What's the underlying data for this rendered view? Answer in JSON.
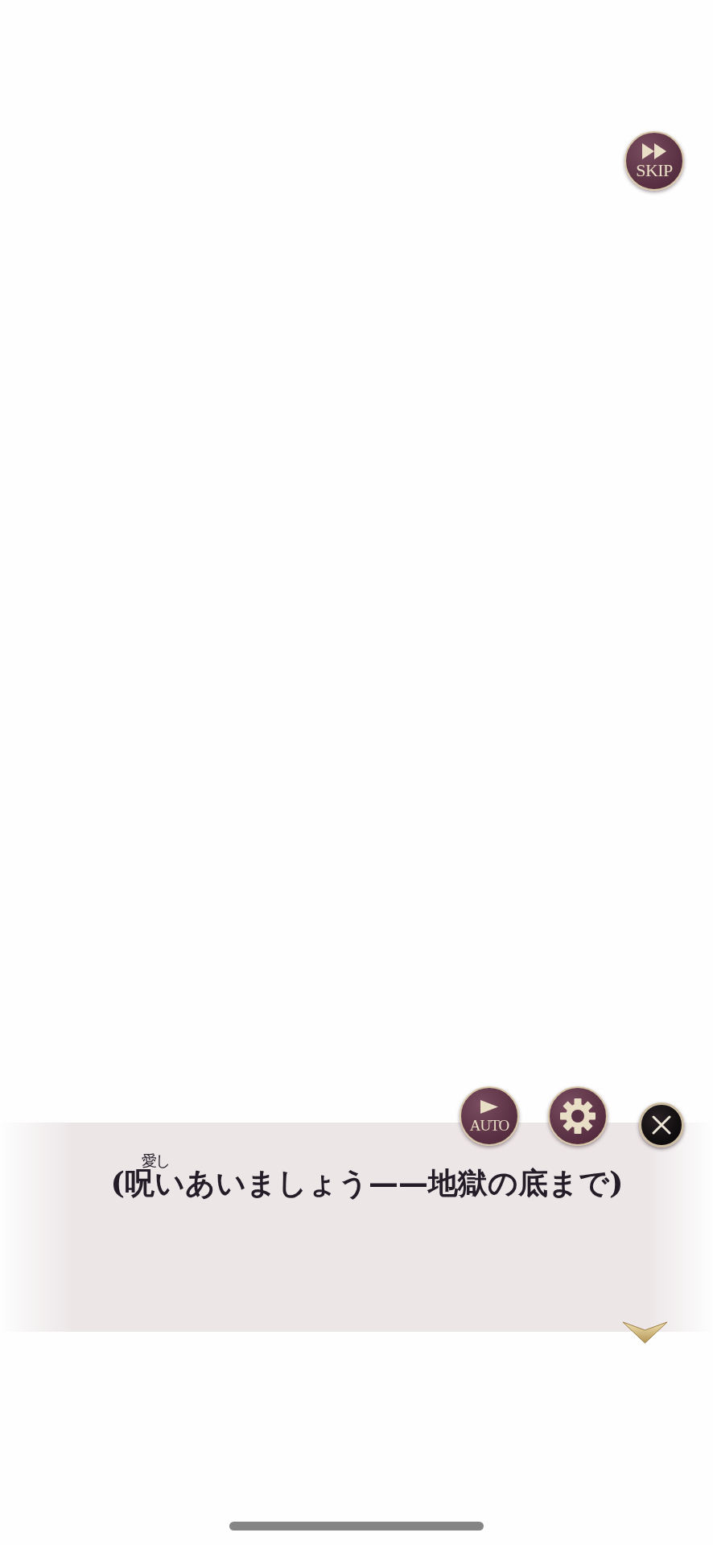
{
  "skip_button": {
    "label": "SKIP"
  },
  "controls": [
    {
      "kind": "auto",
      "label": "AUTO"
    },
    {
      "kind": "settings"
    },
    {
      "kind": "close"
    }
  ],
  "dialogue": {
    "segments": [
      {
        "text": "("
      },
      {
        "text": "呪い",
        "ruby": "愛し"
      },
      {
        "text": "あいましょう——地獄の底まで)"
      }
    ]
  }
}
